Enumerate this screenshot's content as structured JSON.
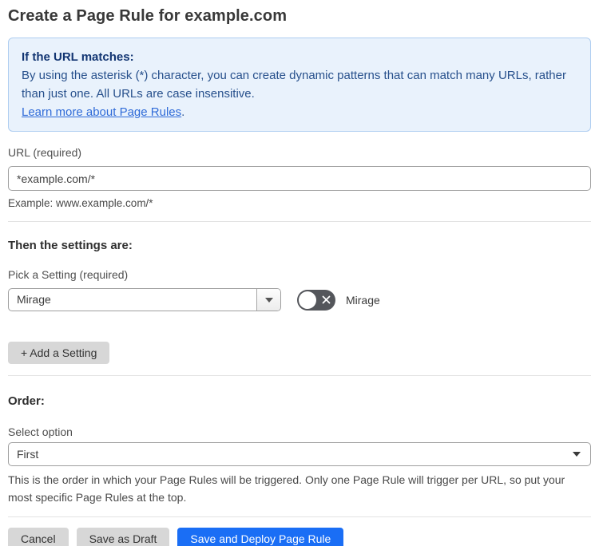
{
  "page": {
    "title": "Create a Page Rule for example.com"
  },
  "info_box": {
    "heading": "If the URL matches:",
    "body": "By using the asterisk (*) character, you can create dynamic patterns that can match many URLs, rather than just one. All URLs are case insensitive.",
    "link_text": "Learn more about Page Rules",
    "link_suffix": "."
  },
  "url_field": {
    "label": "URL (required)",
    "value": "*example.com/*",
    "helper": "Example: www.example.com/*"
  },
  "settings_section": {
    "heading": "Then the settings are:",
    "setting_label": "Pick a Setting (required)",
    "setting_value": "Mirage",
    "toggle": {
      "state": "off",
      "label": "Mirage",
      "icon": "x-icon"
    },
    "add_setting_button": "+ Add a Setting"
  },
  "order_section": {
    "heading": "Order:",
    "label": "Select option",
    "value": "First",
    "helper": "This is the order in which your Page Rules will be triggered. Only one Page Rule will trigger per URL, so put your most specific Page Rules at the top."
  },
  "footer": {
    "cancel_label": "Cancel",
    "save_draft_label": "Save as Draft",
    "save_deploy_label": "Save and Deploy Page Rule"
  },
  "colors": {
    "info_bg": "#e9f2fc",
    "info_border": "#aecdf0",
    "info_heading_text": "#123572",
    "info_body_text": "#27508c",
    "link": "#2f6bd8",
    "primary_button": "#1a6ef5",
    "gray_button": "#d7d7d7",
    "toggle_off_bg": "#54565b",
    "divider": "#e3e3e3"
  }
}
